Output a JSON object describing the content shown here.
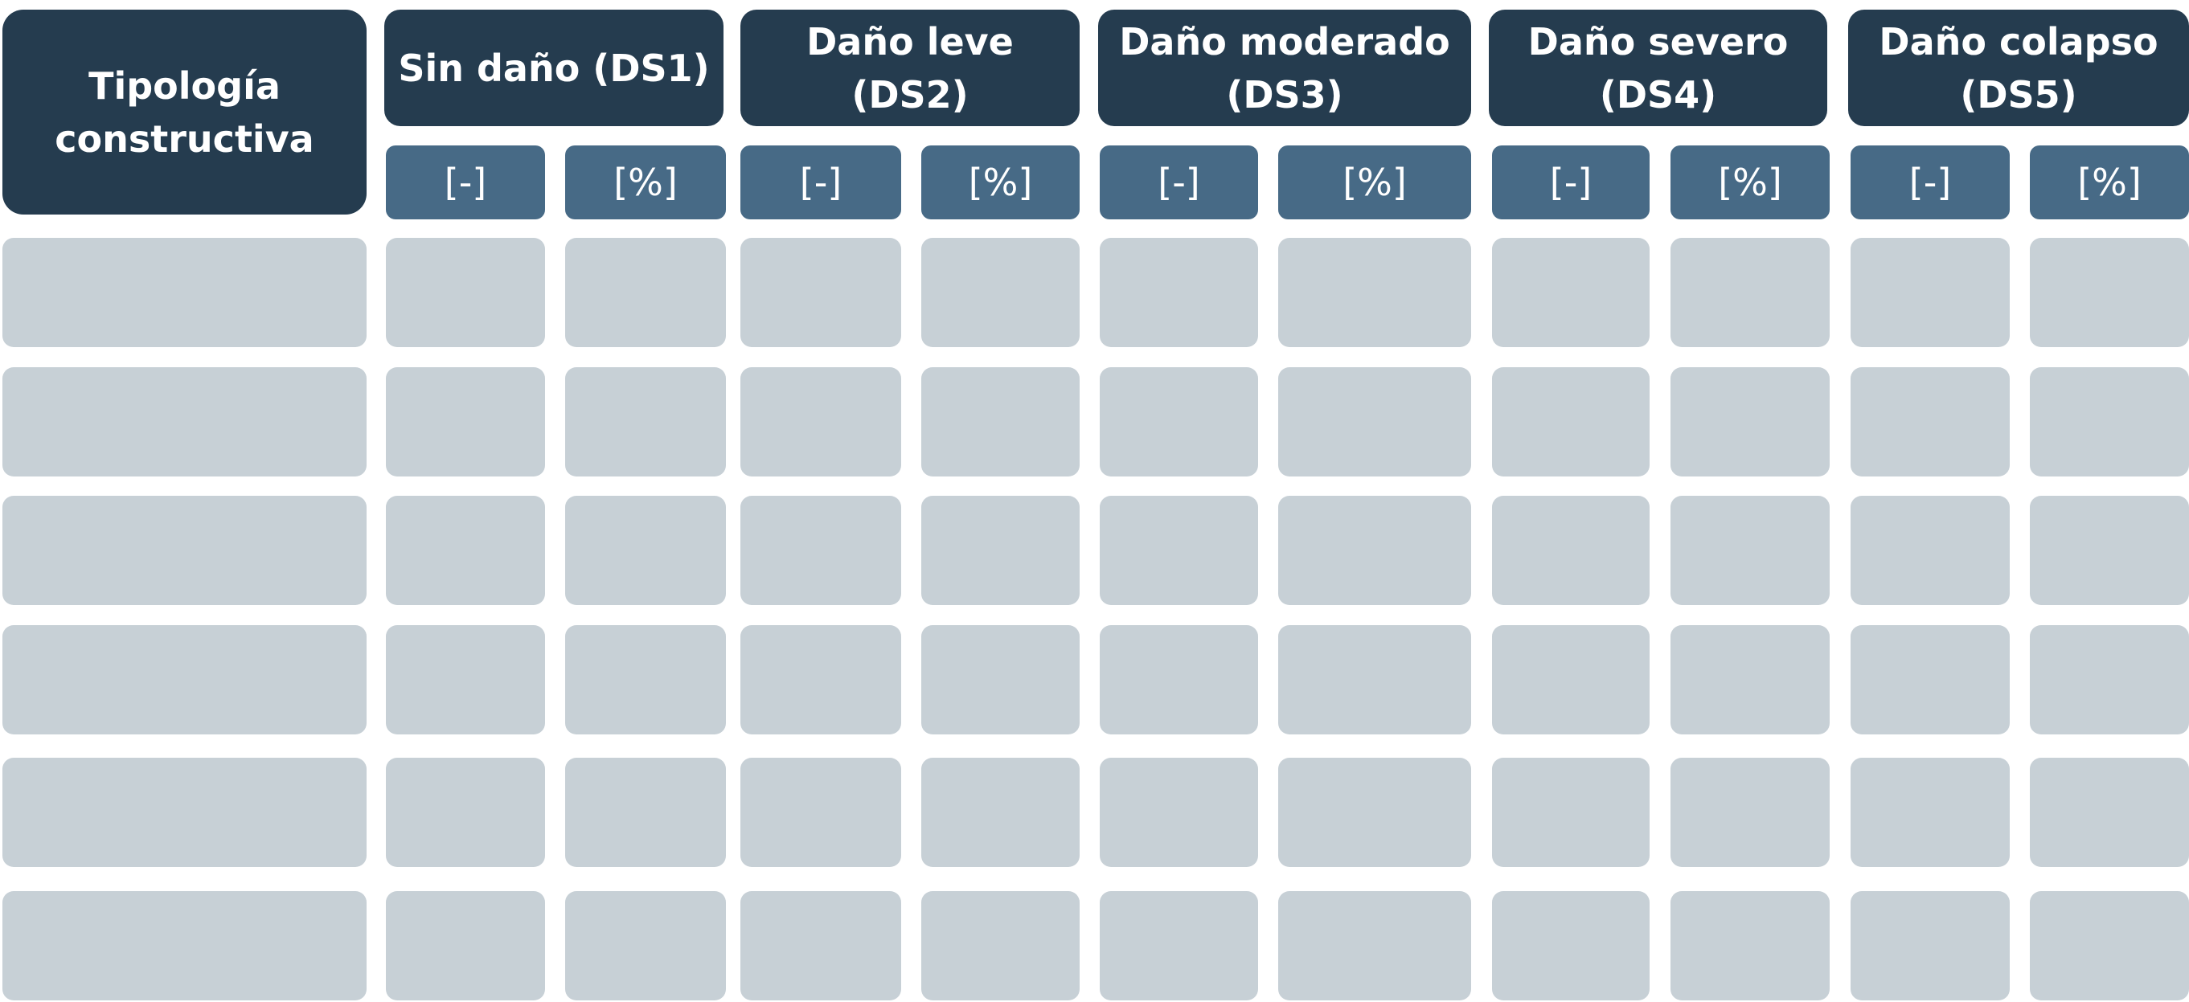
{
  "header": {
    "type_label": "Tipología constructiva",
    "type_lines": [
      "Tipología",
      "constructiva"
    ],
    "groups": [
      {
        "lines": [
          "Sin daño (DS1)"
        ],
        "units": [
          "[-]",
          "[%]"
        ]
      },
      {
        "lines": [
          "Daño leve",
          "(DS2)"
        ],
        "units": [
          "[-]",
          "[%]"
        ]
      },
      {
        "lines": [
          "Daño moderado",
          "(DS3)"
        ],
        "units": [
          "[-]",
          "[%]"
        ]
      },
      {
        "lines": [
          "Daño severo",
          "(DS4)"
        ],
        "units": [
          "[-]",
          "[%]"
        ]
      },
      {
        "lines": [
          "Daño colapso",
          "(DS5)"
        ],
        "units": [
          "[-]",
          "[%]"
        ]
      }
    ]
  },
  "rows": [
    {
      "cells": [
        "",
        "",
        "",
        "",
        "",
        "",
        "",
        "",
        "",
        "",
        ""
      ]
    },
    {
      "cells": [
        "",
        "",
        "",
        "",
        "",
        "",
        "",
        "",
        "",
        "",
        ""
      ]
    },
    {
      "cells": [
        "",
        "",
        "",
        "",
        "",
        "",
        "",
        "",
        "",
        "",
        ""
      ]
    },
    {
      "cells": [
        "",
        "",
        "",
        "",
        "",
        "",
        "",
        "",
        "",
        "",
        ""
      ]
    },
    {
      "cells": [
        "",
        "",
        "",
        "",
        "",
        "",
        "",
        "",
        "",
        "",
        ""
      ]
    },
    {
      "cells": [
        "",
        "",
        "",
        "",
        "",
        "",
        "",
        "",
        "",
        "",
        ""
      ]
    }
  ],
  "colors": {
    "header_dark": "#253c4f",
    "header_sub": "#476a86",
    "cell_fill": "#c7d0d6",
    "header_text": "#ffffff"
  }
}
